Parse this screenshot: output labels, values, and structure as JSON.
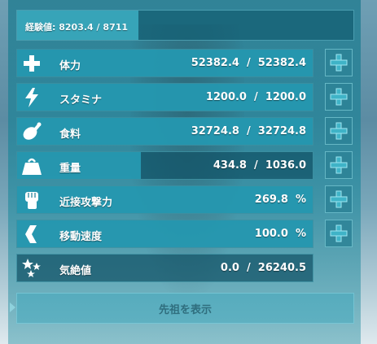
{
  "experience": {
    "label": "経験値:",
    "current": "8203.4",
    "separator": "/",
    "max_partial": "8711",
    "progress_fraction": 0.36
  },
  "stats": [
    {
      "key": "health",
      "icon": "plus-icon",
      "label": "体力",
      "value": "52382.4  /  52382.4",
      "fill_fraction": 1.0,
      "has_plus_button": true
    },
    {
      "key": "stamina",
      "icon": "lightning-icon",
      "label": "スタミナ",
      "value": "1200.0  /  1200.0",
      "fill_fraction": 1.0,
      "has_plus_button": true
    },
    {
      "key": "food",
      "icon": "drumstick-icon",
      "label": "食料",
      "value": "32724.8  /  32724.8",
      "fill_fraction": 1.0,
      "has_plus_button": true
    },
    {
      "key": "weight",
      "icon": "weight-icon",
      "label": "重量",
      "value": "434.8  /  1036.0",
      "fill_fraction": 0.42,
      "has_plus_button": true
    },
    {
      "key": "melee",
      "icon": "fist-icon",
      "label": "近接攻撃力",
      "value": "269.8  %",
      "fill_fraction": 1.0,
      "has_plus_button": true
    },
    {
      "key": "speed",
      "icon": "boot-icon",
      "label": "移動速度",
      "value": "100.0  %",
      "fill_fraction": 1.0,
      "has_plus_button": true
    },
    {
      "key": "torpor",
      "icon": "stars-icon",
      "label": "気絶値",
      "value": "0.0  /  26240.5",
      "fill_fraction": 0.0,
      "has_plus_button": false
    }
  ],
  "ancestry_button": {
    "label": "先祖を表示"
  },
  "colors": {
    "accent": "#2aa3bd",
    "bar_dark": "#0f5064",
    "text": "#ffffff"
  }
}
